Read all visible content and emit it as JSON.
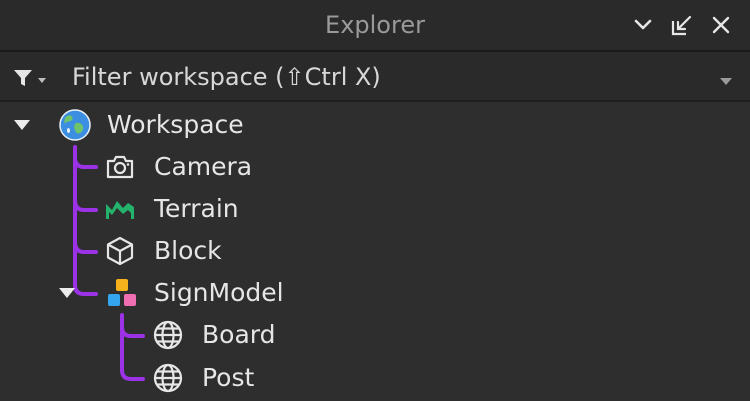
{
  "panel": {
    "title": "Explorer",
    "buttons": {
      "collapse_icon": "chevron-down-icon",
      "dock_icon": "undock-icon",
      "close_icon": "close-icon"
    }
  },
  "filter": {
    "placeholder": "Filter workspace (⇧Ctrl X)",
    "value": ""
  },
  "tree": {
    "items": [
      {
        "label": "Workspace",
        "icon": "globe-icon",
        "expanded": true
      },
      {
        "label": "Camera",
        "icon": "camera-icon"
      },
      {
        "label": "Terrain",
        "icon": "terrain-icon"
      },
      {
        "label": "Block",
        "icon": "cube-icon"
      },
      {
        "label": "SignModel",
        "icon": "model-icon",
        "expanded": true
      },
      {
        "label": "Board",
        "icon": "globe-outline-icon"
      },
      {
        "label": "Post",
        "icon": "globe-outline-icon"
      }
    ]
  },
  "colors": {
    "hierarchy_line": "#9b32e6",
    "terrain": "#23b36b",
    "background": "#2e2e2e"
  }
}
